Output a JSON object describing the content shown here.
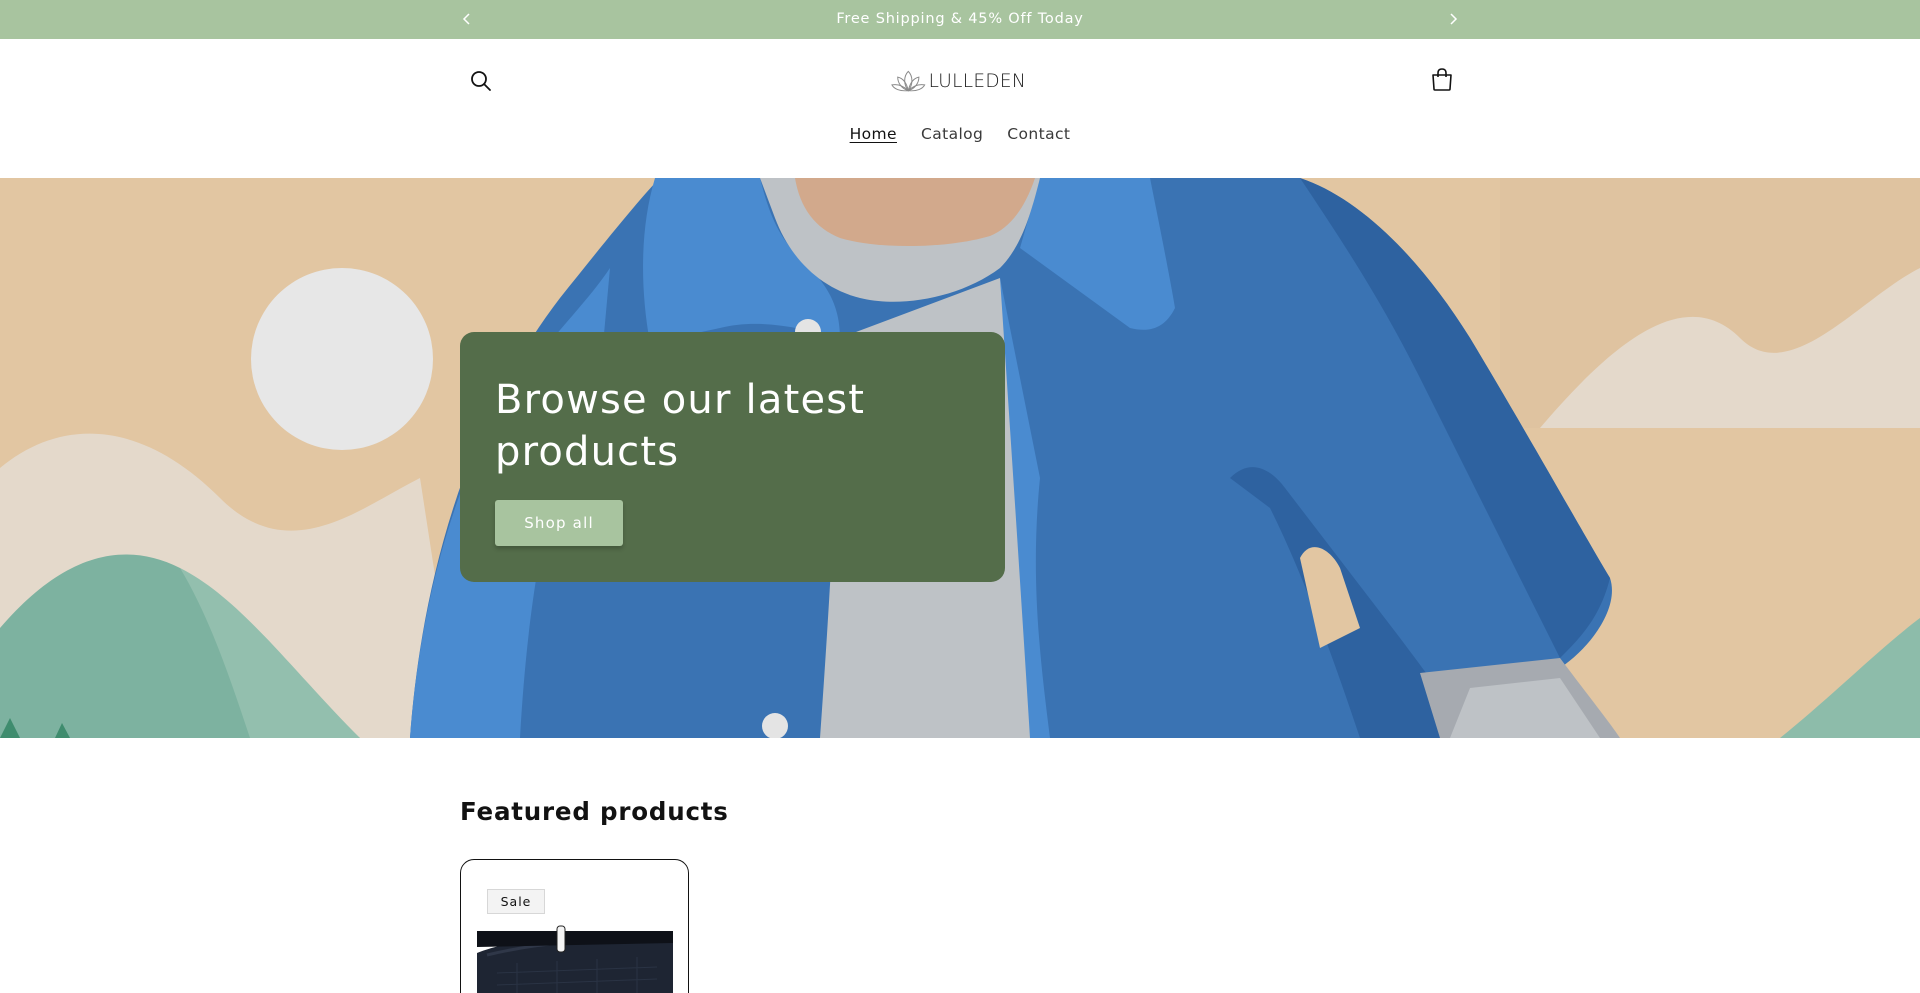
{
  "announcement": {
    "message": "Free Shipping & 45% Off Today",
    "prev_icon": "chevron-left-icon",
    "next_icon": "chevron-right-icon"
  },
  "header": {
    "logo_text": "LULLEDEN",
    "search_icon": "search-icon",
    "cart_icon": "cart-icon",
    "nav": [
      {
        "label": "Home",
        "active": true
      },
      {
        "label": "Catalog",
        "active": false
      },
      {
        "label": "Contact",
        "active": false
      }
    ]
  },
  "hero": {
    "title": "Browse our latest products",
    "button_label": "Shop all"
  },
  "featured": {
    "title": "Featured products",
    "products": [
      {
        "badge": "Sale",
        "image": "black-fanny-pack-image"
      }
    ]
  },
  "colors": {
    "announcement_bg": "#a8c49f",
    "hero_box_bg": "#546d4a",
    "button_bg": "#a8c49f",
    "jacket_blue": "#3a73b3"
  }
}
